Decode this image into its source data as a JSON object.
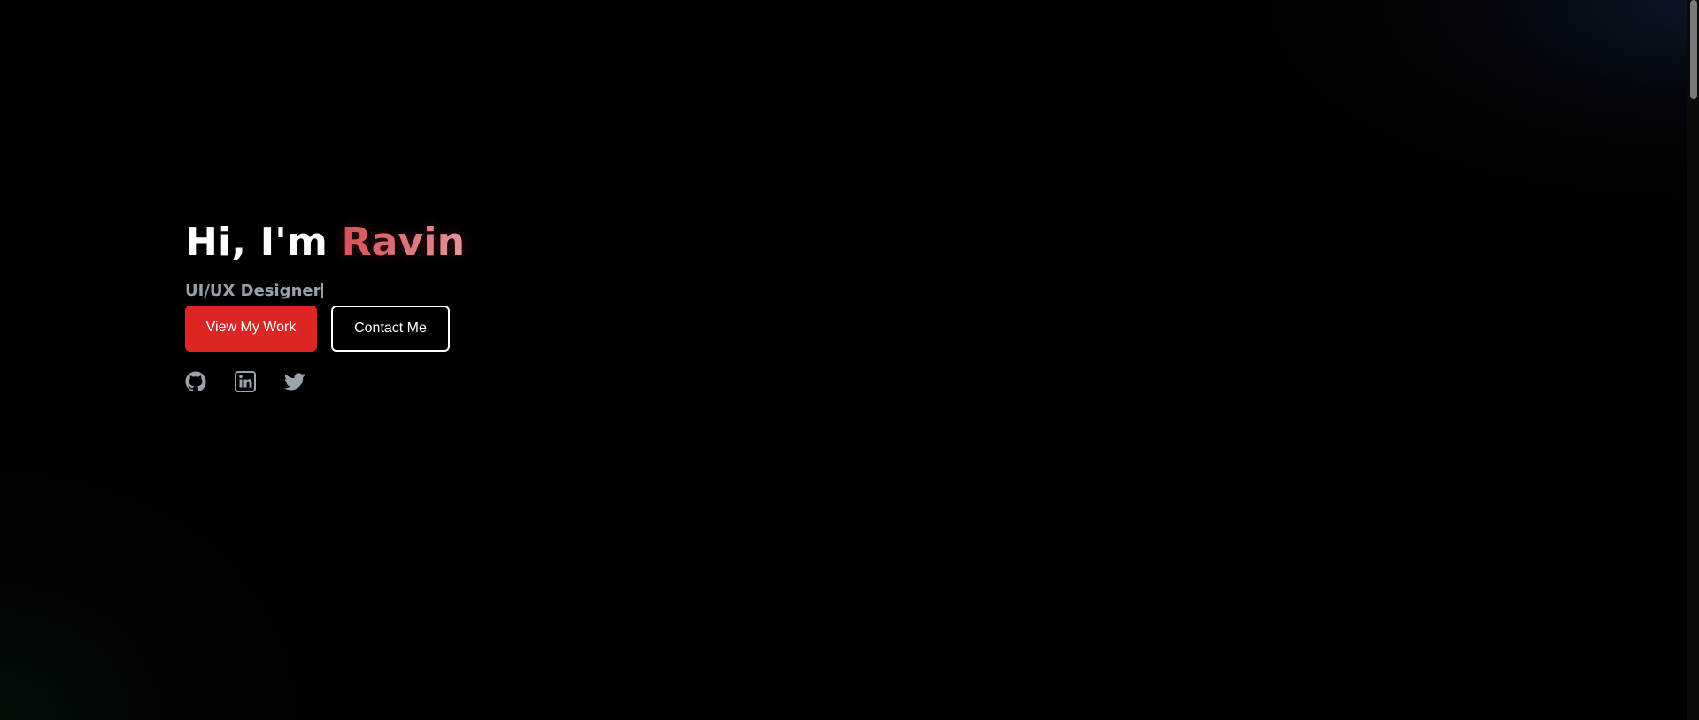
{
  "hero": {
    "greeting": "Hi, I'm",
    "name": "Ravin",
    "role": "UI/UX Designer"
  },
  "buttons": {
    "primary_label": "View My Work",
    "secondary_label": "Contact Me"
  },
  "socials": [
    {
      "icon": "github-icon"
    },
    {
      "icon": "linkedin-icon"
    },
    {
      "icon": "twitter-icon"
    }
  ],
  "colors": {
    "background": "#000000",
    "accent": "#dc2626",
    "name_gradient_start": "#d9525a",
    "name_gradient_end": "#e6a0a6",
    "muted_text": "#9aa0aa"
  }
}
